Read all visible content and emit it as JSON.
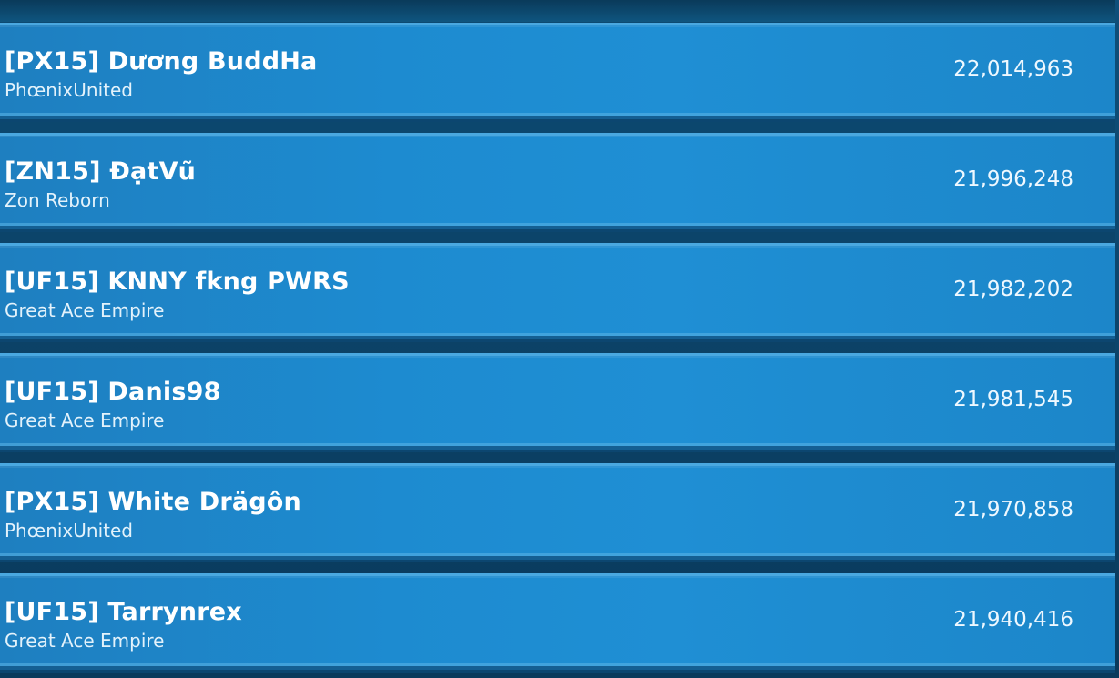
{
  "leaderboard": {
    "rows": [
      {
        "name": "[PX15] Dương BuddHa",
        "alliance": "PhœnixUnited",
        "power": "22,014,963"
      },
      {
        "name": "[ZN15] ĐạtVũ",
        "alliance": "Zon Reborn",
        "power": "21,996,248"
      },
      {
        "name": "[UF15] KNNY fkng PWRS",
        "alliance": "Great Ace Empire",
        "power": "21,982,202"
      },
      {
        "name": "[UF15] Danis98",
        "alliance": "Great Ace Empire",
        "power": "21,981,545"
      },
      {
        "name": "[PX15] White Drägôn",
        "alliance": "PhœnixUnited",
        "power": "21,970,858"
      },
      {
        "name": "[UF15] Tarrynrex",
        "alliance": "Great Ace Empire",
        "power": "21,940,416"
      }
    ]
  },
  "colors": {
    "row_fill": "#1d8bd0",
    "row_highlight": "#4aa8e0",
    "background": "#0a3a5c",
    "text": "#ffffff"
  }
}
